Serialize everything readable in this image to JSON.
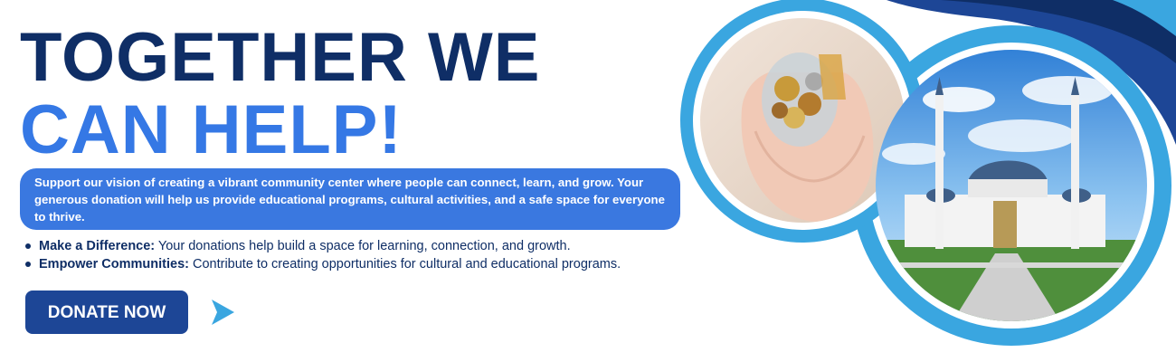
{
  "headline": {
    "line1": "TOGETHER WE",
    "line2": "CAN HELP!"
  },
  "intro_text": "Support our vision of creating a vibrant community center where people can connect, learn, and grow. Your generous donation will help us provide educational programs, cultural activities, and a safe space for everyone to thrive.",
  "bullets": [
    {
      "title": "Make a Difference:",
      "text": " Your donations help build a space for learning, connection, and growth."
    },
    {
      "title": "Empower Communities:",
      "text": " Contribute to creating opportunities for cultural and educational programs."
    }
  ],
  "cta": {
    "label": "DONATE NOW"
  },
  "colors": {
    "navy": "#0f2e66",
    "accent_blue": "#3578e5",
    "button_bg": "#1d4696",
    "sky_blue": "#3aa6e0"
  },
  "images": {
    "left_circle": "hands-holding-coin-jar",
    "right_circle": "mosque-with-two-minarets"
  }
}
